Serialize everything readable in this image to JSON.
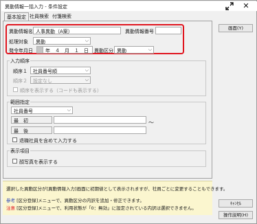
{
  "window": {
    "title": "異動情報一括入力 - 条件設定",
    "expand_icon": "expand-arrows-icon",
    "close_icon": "close-icon"
  },
  "tabs": [
    {
      "label": "基本設定",
      "active": true
    },
    {
      "label": "社員検索",
      "active": false
    },
    {
      "label": "付箋検索",
      "active": false
    }
  ],
  "basic": {
    "info_name_label": "異動情報名",
    "info_name_value": "人事異動（A案）",
    "info_no_label": "異動情報番号",
    "info_no_value": "",
    "target_label": "処理対象",
    "target_value": "異動",
    "date_label": "発令年月日",
    "date_value": "年　４　月　１　日",
    "category_label": "異動区分",
    "category_value": "異動"
  },
  "input_order": {
    "title": "入力順序",
    "order1_label": "順序１",
    "order1_value": "社員番号順",
    "order2_label": "順序２",
    "order2_value": "設定なし",
    "show_order_label": "順序を表示する",
    "show_code_label": "（コードも表示する）"
  },
  "range": {
    "title": "範囲指定",
    "field_value": "社員番号",
    "first_label": "最　初",
    "last_label": "最　後",
    "tilde": "～",
    "include_retired_label": "退職社員を含めて入力する"
  },
  "display": {
    "title": "表示項目",
    "photo_label": "顔写真を表示する"
  },
  "buttons": {
    "screen": "画面(Y)",
    "cancel": "ｷｬﾝｾﾙ",
    "help": "操作説明(H)"
  },
  "notes": {
    "line1": "選択した異動区分が[異動情報入力]画面に初期値として表示されますが、社員ごとに変更することもできます。",
    "ref_tag": "参考",
    "line2": "[区分登録]メニューで、異動区分の内訳を追加・修正できます。",
    "warn_tag": "注意",
    "line3": "[区分登録]メニューで、利用状態が「0：無効」に設定されている内訳は選択できません。"
  }
}
